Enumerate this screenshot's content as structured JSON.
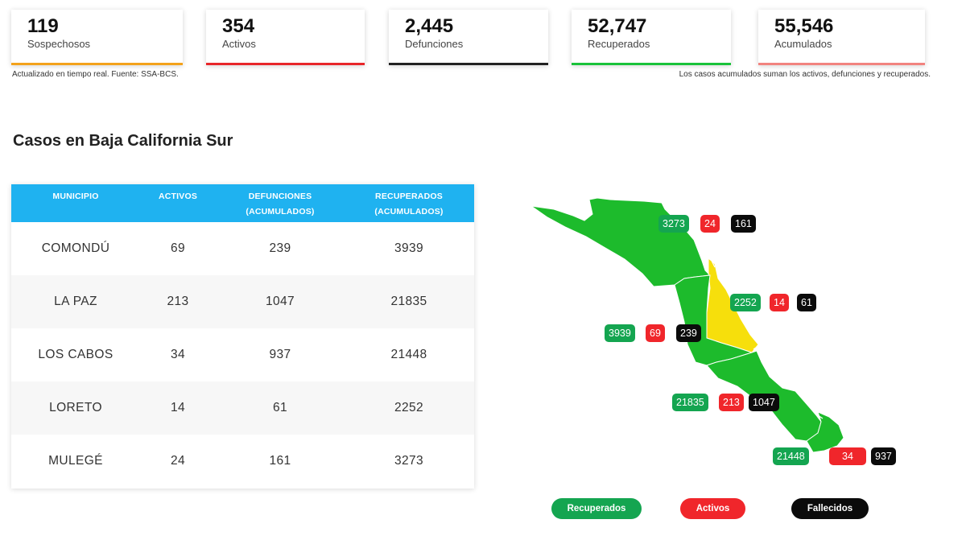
{
  "stats": [
    {
      "value": "119",
      "label": "Sospechosos",
      "color": "#f3a21b"
    },
    {
      "value": "354",
      "label": "Activos",
      "color": "#e8262a"
    },
    {
      "value": "2,445",
      "label": "Defunciones",
      "color": "#222222"
    },
    {
      "value": "52,747",
      "label": "Recuperados",
      "color": "#19c23a"
    },
    {
      "value": "55,546",
      "label": "Acumulados",
      "color": "#f2837f"
    }
  ],
  "notes": {
    "left": "Actualizado en tiempo real. Fuente: SSA-BCS.",
    "right": "Los casos acumulados suman los activos, defunciones y recuperados."
  },
  "section_title": "Casos en Baja California Sur",
  "table": {
    "headers": [
      [
        "MUNICIPIO"
      ],
      [
        "ACTIVOS"
      ],
      [
        "DEFUNCIONES",
        "(ACUMULADOS)"
      ],
      [
        "RECUPERADOS",
        "(ACUMULADOS)"
      ]
    ],
    "rows": [
      [
        "COMONDÚ",
        "69",
        "239",
        "3939"
      ],
      [
        "LA PAZ",
        "213",
        "1047",
        "21835"
      ],
      [
        "LOS CABOS",
        "34",
        "937",
        "21448"
      ],
      [
        "LORETO",
        "14",
        "61",
        "2252"
      ],
      [
        "MULEGÉ",
        "24",
        "161",
        "3273"
      ]
    ]
  },
  "map": {
    "badges": [
      {
        "recovered": "3273",
        "active": "24",
        "deaths": "161"
      },
      {
        "recovered": "2252",
        "active": "14",
        "deaths": "61"
      },
      {
        "recovered": "3939",
        "active": "69",
        "deaths": "239"
      },
      {
        "recovered": "21835",
        "active": "213",
        "deaths": "1047"
      },
      {
        "recovered": "21448",
        "active": "34",
        "deaths": "937"
      }
    ],
    "colors": {
      "region": "#1dbb2c",
      "highlight": "#f6df0c"
    }
  },
  "legend": [
    {
      "label": "Recuperados",
      "color": "#14a550"
    },
    {
      "label": "Activos",
      "color": "#f0262b"
    },
    {
      "label": "Fallecidos",
      "color": "#0b0b0b"
    }
  ]
}
